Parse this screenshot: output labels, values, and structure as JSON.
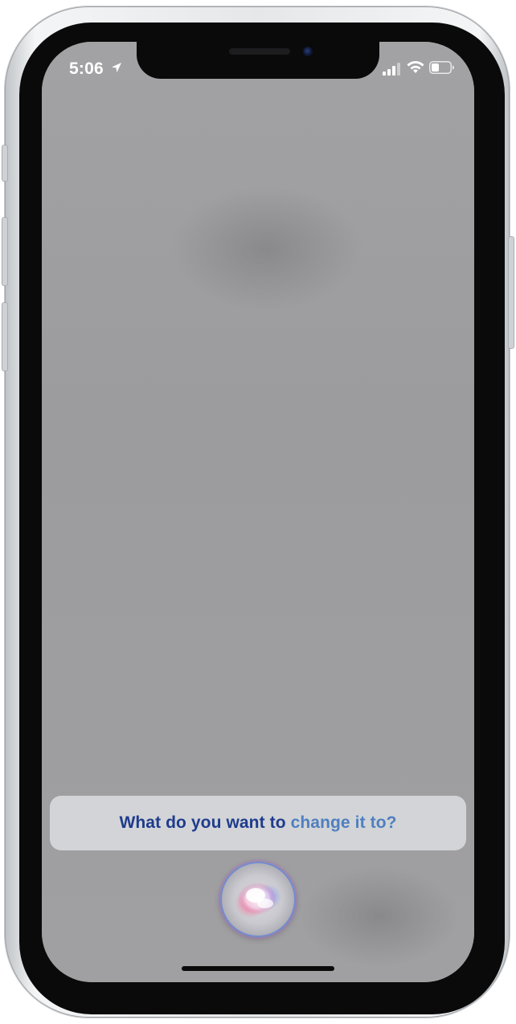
{
  "status_bar": {
    "time": "5:06",
    "location_icon": "location-arrow-icon",
    "signal_icon": "cellular-signal-icon",
    "wifi_icon": "wifi-icon",
    "battery_icon": "battery-icon"
  },
  "siri": {
    "prompt_part1": "What do you want to ",
    "prompt_part2": "change it to?",
    "orb_icon": "siri-orb-icon"
  },
  "colors": {
    "prompt_primary": "#1f3c8c",
    "prompt_secondary": "#4f7fc0",
    "wallpaper": "#9c9c9e"
  }
}
